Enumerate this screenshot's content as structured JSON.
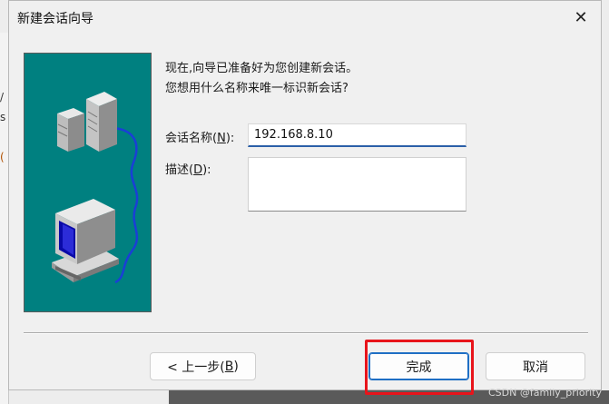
{
  "dialog": {
    "title": "新建会话向导",
    "close_glyph": "✕"
  },
  "intro": {
    "line1": "现在,向导已准备好为您创建新会话。",
    "line2": "您想用什么名称来唯一标识新会话?"
  },
  "form": {
    "name_label_prefix": "会话名称(",
    "name_label_key": "N",
    "name_label_suffix": "):",
    "name_value": "192.168.8.10",
    "desc_label_prefix": "描述(",
    "desc_label_key": "D",
    "desc_label_suffix": "):",
    "desc_value": ""
  },
  "buttons": {
    "back_prefix": "< 上一步(",
    "back_key": "B",
    "back_suffix": ")",
    "finish": "完成",
    "cancel": "取消"
  },
  "background": {
    "frag1": "/",
    "frag2": "s",
    "frag3": "("
  },
  "watermark": "CSDN @family_priority",
  "colors": {
    "illustration_bg": "#008080",
    "highlight_border": "#e8141b",
    "focus_accent": "#1f6fc4"
  },
  "icons": [
    "server-tower-icon",
    "computer-monitor-icon",
    "network-cable-icon"
  ]
}
